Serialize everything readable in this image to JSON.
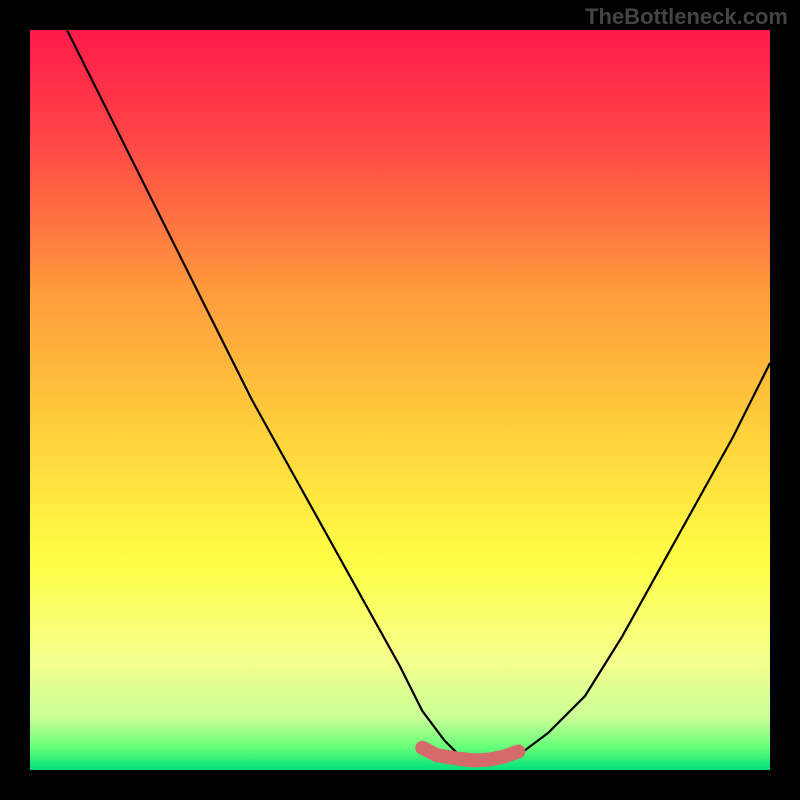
{
  "watermark": "TheBottleneck.com",
  "chart_data": {
    "type": "line",
    "title": "",
    "xlabel": "",
    "ylabel": "",
    "xlim": [
      0,
      100
    ],
    "ylim": [
      0,
      100
    ],
    "series": [
      {
        "name": "curve",
        "color": "#000000",
        "x": [
          5,
          10,
          15,
          20,
          25,
          30,
          35,
          40,
          45,
          50,
          53,
          56,
          58,
          60,
          63,
          66,
          70,
          75,
          80,
          85,
          90,
          95,
          100
        ],
        "y": [
          100,
          90,
          80,
          70,
          60,
          50,
          41,
          32,
          23,
          14,
          8,
          4,
          2,
          1,
          1,
          2,
          5,
          10,
          18,
          27,
          36,
          45,
          55
        ]
      },
      {
        "name": "flat-highlight",
        "color": "#d46a6a",
        "x": [
          53,
          55,
          58,
          60,
          62,
          64,
          66
        ],
        "y": [
          3,
          2,
          1.5,
          1.3,
          1.4,
          1.8,
          2.5
        ]
      }
    ],
    "background_gradient": {
      "stops": [
        {
          "offset": 0.0,
          "color": "#ff1a4a"
        },
        {
          "offset": 0.15,
          "color": "#ff4646"
        },
        {
          "offset": 0.35,
          "color": "#ff9a3c"
        },
        {
          "offset": 0.55,
          "color": "#ffd23c"
        },
        {
          "offset": 0.72,
          "color": "#ffff46"
        },
        {
          "offset": 0.85,
          "color": "#f5ff8c"
        },
        {
          "offset": 0.93,
          "color": "#c8ff96"
        },
        {
          "offset": 0.97,
          "color": "#64ff78"
        },
        {
          "offset": 1.0,
          "color": "#00e07a"
        }
      ]
    }
  }
}
